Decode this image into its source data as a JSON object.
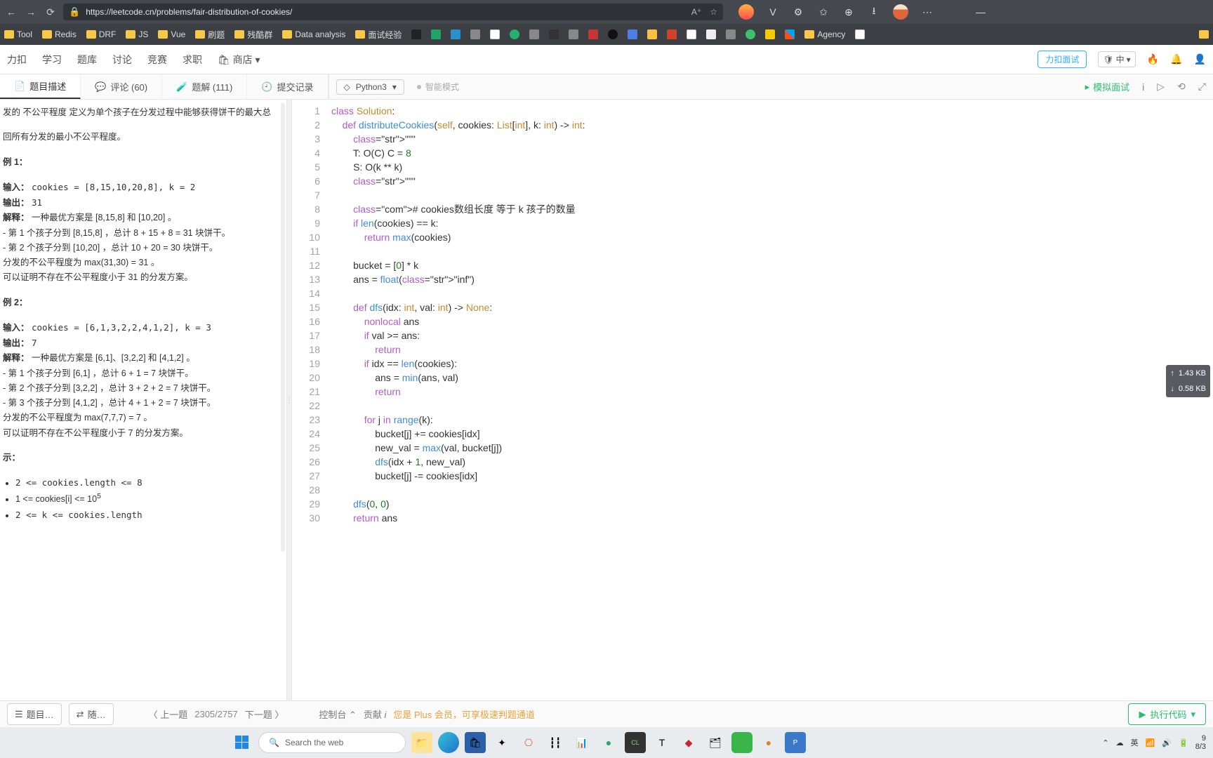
{
  "browser": {
    "url": "https://leetcode.cn/problems/fair-distribution-of-cookies/",
    "font_default_label": "A^A",
    "ext_icons": [
      "V",
      "⚙",
      "☆",
      "⊞",
      "↓",
      "…"
    ]
  },
  "bookmarks": [
    "Tool",
    "Redis",
    "DRF",
    "JS",
    "Vue",
    "刷题",
    "残酷群",
    "Data analysis",
    "面试经验"
  ],
  "bookmarks_right": "Agency",
  "site_nav": {
    "items": [
      "力扣",
      "学习",
      "题库",
      "讨论",
      "竞赛",
      "求职"
    ],
    "store": "🛍 商店",
    "btn_interview": "力扣面试",
    "lang": "中",
    "fire_on": true
  },
  "prob_tabs": {
    "desc": "题目描述",
    "comments": "评论 (60)",
    "solutions": "题解 (111)",
    "submissions": "提交记录"
  },
  "editor_bar": {
    "language": "Python3",
    "smart": "智能模式",
    "mock": "模拟面试"
  },
  "problem": {
    "intro1": "发的 不公平程度 定义为单个孩子在分发过程中能够获得饼干的最大总",
    "intro2": "回所有分发的最小不公平程度。",
    "ex1_title": "例 1：",
    "ex1_in_label": "输入：",
    "ex1_in_val": "cookies = [8,15,10,20,8], k = 2",
    "ex1_out_label": "输出：",
    "ex1_out_val": "31",
    "ex1_exp_label": "解释：",
    "ex1_exp_l1": "一种最优方案是 [8,15,8] 和 [10,20] 。",
    "ex1_exp_l2": "- 第 1 个孩子分到 [8,15,8] ，总计 8 + 15 + 8 = 31 块饼干。",
    "ex1_exp_l3": "- 第 2 个孩子分到 [10,20] ，总计 10 + 20 = 30 块饼干。",
    "ex1_exp_l4": "分发的不公平程度为 max(31,30) = 31 。",
    "ex1_exp_l5": "可以证明不存在不公平程度小于 31 的分发方案。",
    "ex2_title": "例 2：",
    "ex2_in_val": "cookies = [6,1,3,2,2,4,1,2], k = 3",
    "ex2_out_val": "7",
    "ex2_exp_l1": "一种最优方案是 [6,1]、[3,2,2] 和 [4,1,2] 。",
    "ex2_exp_l2": "- 第 1 个孩子分到 [6,1] ，总计 6 + 1 = 7 块饼干。",
    "ex2_exp_l3": "- 第 2 个孩子分到 [3,2,2] ，总计 3 + 2 + 2 = 7 块饼干。",
    "ex2_exp_l4": "- 第 3 个孩子分到 [4,1,2] ，总计 4 + 1 + 2 = 7 块饼干。",
    "ex2_exp_l5": "分发的不公平程度为 max(7,7,7) = 7 。",
    "ex2_exp_l6": "可以证明不存在不公平程度小于 7 的分发方案。",
    "hint_title": "示：",
    "c1": "2 <= cookies.length <= 8",
    "c2a": "1 <= cookies[i] <= 10",
    "c2b": "5",
    "c3": "2 <= k <= cookies.length"
  },
  "bottom": {
    "list_btn": "题目…",
    "random_btn": "随…",
    "prev": "上一题",
    "counter": "2305/2757",
    "next": "下一题",
    "console": "控制台",
    "contrib": "贡献",
    "plus_msg": "您是 Plus 会员，可享极速判题通道",
    "run": "执行代码"
  },
  "taskbar": {
    "search_placeholder": "Search the web",
    "time": "9",
    "date": "8/3"
  },
  "code_lines": [
    "class Solution:",
    "    def distributeCookies(self, cookies: List[int], k: int) -> int:",
    "        \"\"\"",
    "        T: O(C) C = 8",
    "        S: O(k ** k)",
    "        \"\"\"",
    "",
    "        # cookies数组长度 等于 k 孩子的数量",
    "        if len(cookies) == k:",
    "            return max(cookies)",
    "",
    "        bucket = [0] * k",
    "        ans = float(\"inf\")",
    "",
    "        def dfs(idx: int, val: int) -> None:",
    "            nonlocal ans",
    "            if val >= ans:",
    "                return",
    "            if idx == len(cookies):",
    "                ans = min(ans, val)",
    "                return",
    "",
    "            for j in range(k):",
    "                bucket[j] += cookies[idx]",
    "                new_val = max(val, bucket[j])",
    "                dfs(idx + 1, new_val)",
    "                bucket[j] -= cookies[idx]",
    "",
    "        dfs(0, 0)",
    "        return ans"
  ],
  "size_info": {
    "up": "1.43 KB",
    "down": "0.58 KB"
  }
}
